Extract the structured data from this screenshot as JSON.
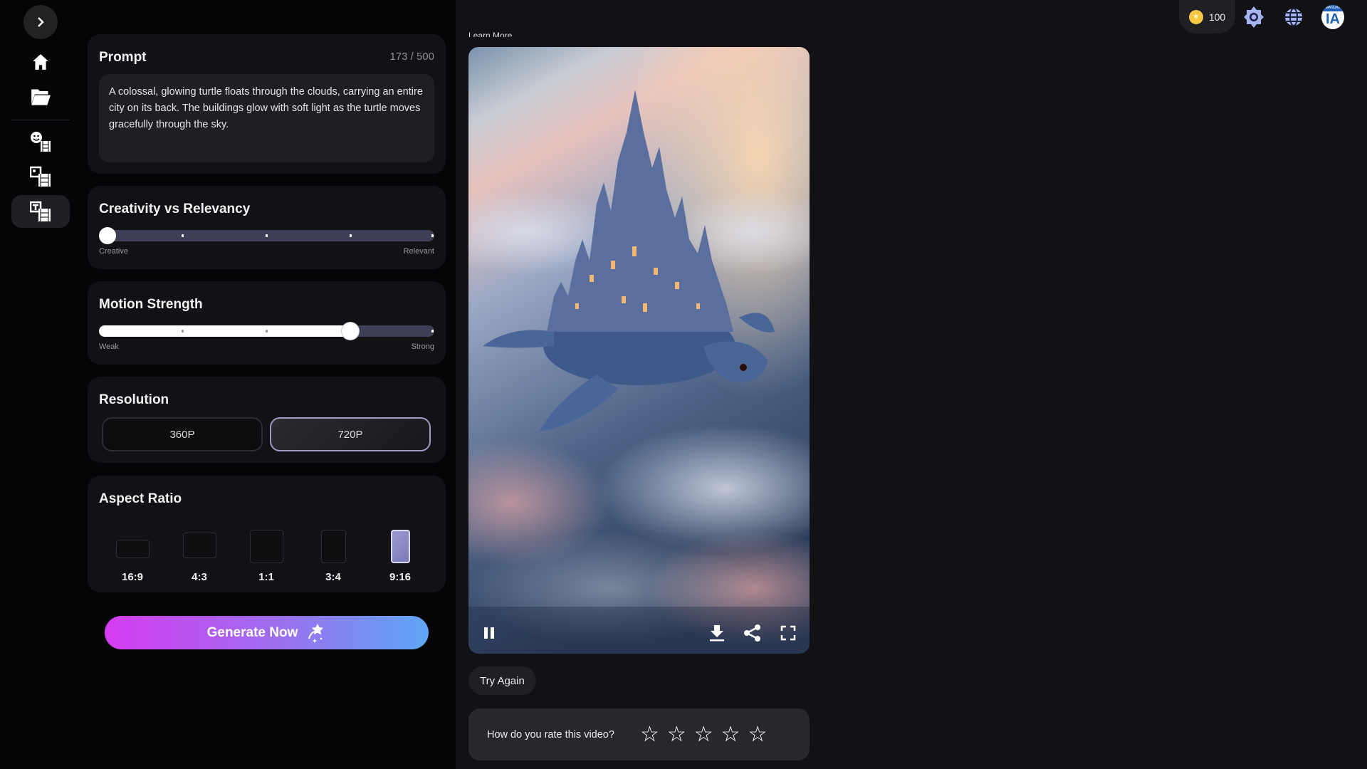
{
  "sidebar": {
    "items": [
      {
        "name": "expand",
        "icon": "chevron-right-icon"
      },
      {
        "name": "home",
        "icon": "home-icon"
      },
      {
        "name": "projects",
        "icon": "folder-open-icon"
      },
      {
        "name": "character-to-video",
        "icon": "face-film-icon"
      },
      {
        "name": "image-to-video",
        "icon": "image-film-icon"
      },
      {
        "name": "text-to-video",
        "icon": "text-film-icon",
        "active": true
      }
    ]
  },
  "prompt": {
    "title": "Prompt",
    "counter": "173 / 500",
    "text": "A colossal, glowing turtle floats through the clouds, carrying an entire city on its back. The buildings glow with soft light as the turtle moves gracefully through the sky."
  },
  "creativity": {
    "title": "Creativity vs Relevancy",
    "min_label": "Creative",
    "max_label": "Relevant",
    "value_percent": 0
  },
  "motion": {
    "title": "Motion Strength",
    "min_label": "Weak",
    "max_label": "Strong",
    "value_percent": 75
  },
  "resolution": {
    "title": "Resolution",
    "options": [
      "360P",
      "720P"
    ],
    "selected": "720P"
  },
  "aspect": {
    "title": "Aspect Ratio",
    "options": [
      "16:9",
      "4:3",
      "1:1",
      "3:4",
      "9:16"
    ],
    "selected": "9:16"
  },
  "generate": {
    "label": "Generate Now",
    "icon": "sparkle-star-icon"
  },
  "header": {
    "credits": "100",
    "credit_icon": "coin-icon",
    "settings_icon": "gear-icon",
    "language_icon": "globe-icon",
    "logo_text": "IA",
    "logo_sub": "MANUAL"
  },
  "main": {
    "learn_more": "Learn More",
    "try_again": "Try Again",
    "rating_prompt": "How do you rate this video?",
    "rating_value": 0,
    "rating_max": 5
  },
  "colors": {
    "accent": "#a5a3d8",
    "gradient_start": "#d63cf2",
    "gradient_end": "#5ea6f7",
    "coin": "#f5c842"
  }
}
